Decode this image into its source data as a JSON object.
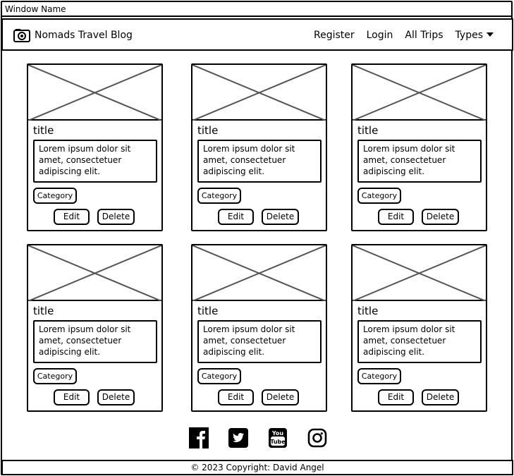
{
  "window": {
    "title": "Window Name"
  },
  "navbar": {
    "brand": "Nomads Travel Blog",
    "links": [
      "Register",
      "Login",
      "All Trips",
      "Types"
    ]
  },
  "cards": [
    {
      "title": "title",
      "text": "Lorem ipsum dolor sit amet, consectetuer adipiscing elit.",
      "category": "Category",
      "edit": "Edit",
      "delete": "Delete"
    },
    {
      "title": "title",
      "text": "Lorem ipsum dolor sit amet, consectetuer adipiscing elit.",
      "category": "Category",
      "edit": "Edit",
      "delete": "Delete"
    },
    {
      "title": "title",
      "text": "Lorem ipsum dolor sit amet, consectetuer adipiscing elit.",
      "category": "Category",
      "edit": "Edit",
      "delete": "Delete"
    },
    {
      "title": "title",
      "text": "Lorem ipsum dolor sit amet, consectetuer adipiscing elit.",
      "category": "Category",
      "edit": "Edit",
      "delete": "Delete"
    },
    {
      "title": "title",
      "text": "Lorem ipsum dolor sit amet, consectetuer adipiscing elit.",
      "category": "Category",
      "edit": "Edit",
      "delete": "Delete"
    },
    {
      "title": "title",
      "text": "Lorem ipsum dolor sit amet, consectetuer adipiscing elit.",
      "category": "Category",
      "edit": "Edit",
      "delete": "Delete"
    }
  ],
  "socials": [
    "facebook-icon",
    "twitter-icon",
    "youtube-icon",
    "instagram-icon"
  ],
  "footer": {
    "copyright": "© 2023 Copyright: David Angel"
  }
}
